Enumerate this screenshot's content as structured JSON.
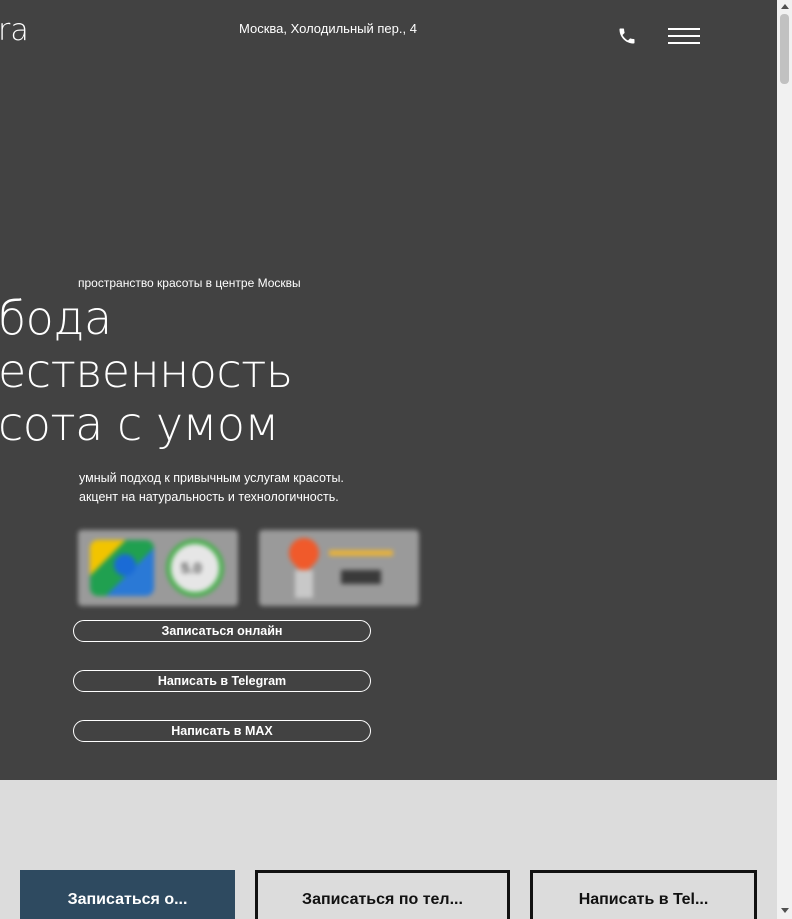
{
  "header": {
    "logo_text": "ra",
    "address": "Москва, Холодильный пер., 4",
    "phone_icon": "phone-icon",
    "menu_icon": "hamburger-menu-icon"
  },
  "hero": {
    "eyebrow": "пространство красоты в центре Москвы",
    "headline": [
      "бода",
      "ественность",
      "сота с умом"
    ],
    "subtext": [
      "умный подход к привычным услугам красоты.",
      "акцент на натуральность и технологичность."
    ],
    "badges": [
      {
        "name": "map-rating-badge",
        "rating": "5.0"
      },
      {
        "name": "map-service-badge"
      }
    ],
    "cta": {
      "book_online": "Записаться онлайн",
      "telegram": "Написать в Telegram",
      "max": "Написать в MAX"
    }
  },
  "bottom_bar": {
    "book_online": "Записаться о...",
    "book_phone": "Записаться по тел...",
    "telegram": "Написать в Tel..."
  },
  "colors": {
    "hero_bg": "#424242",
    "page_bg": "#dcdcdc",
    "accent": "#2e4a60"
  }
}
